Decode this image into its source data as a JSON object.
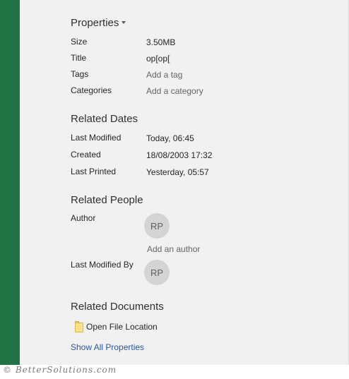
{
  "properties": {
    "title": "Properties",
    "rows": [
      {
        "label": "Size",
        "value": "3.50MB"
      },
      {
        "label": "Title",
        "value": "op[op["
      },
      {
        "label": "Tags",
        "value": "Add a tag"
      },
      {
        "label": "Categories",
        "value": "Add a category"
      }
    ]
  },
  "related_dates": {
    "title": "Related Dates",
    "rows": [
      {
        "label": "Last Modified",
        "value": "Today, 06:45"
      },
      {
        "label": "Created",
        "value": "18/08/2003 17:32"
      },
      {
        "label": "Last Printed",
        "value": "Yesterday, 05:57"
      }
    ]
  },
  "related_people": {
    "title": "Related People",
    "author_label": "Author",
    "author_initials": "RP",
    "add_author": "Add an author",
    "last_modified_by_label": "Last Modified By",
    "last_modified_by_initials": "RP"
  },
  "related_documents": {
    "title": "Related Documents",
    "open_file_location": "Open File Location",
    "folder_icon": "folder-icon"
  },
  "show_all_properties": "Show All Properties",
  "watermark": "© BetterSolutions.com",
  "colors": {
    "accent": "#217346",
    "link": "#2b579a",
    "background": "#f1f1f1",
    "avatar": "#d4d4d4"
  }
}
